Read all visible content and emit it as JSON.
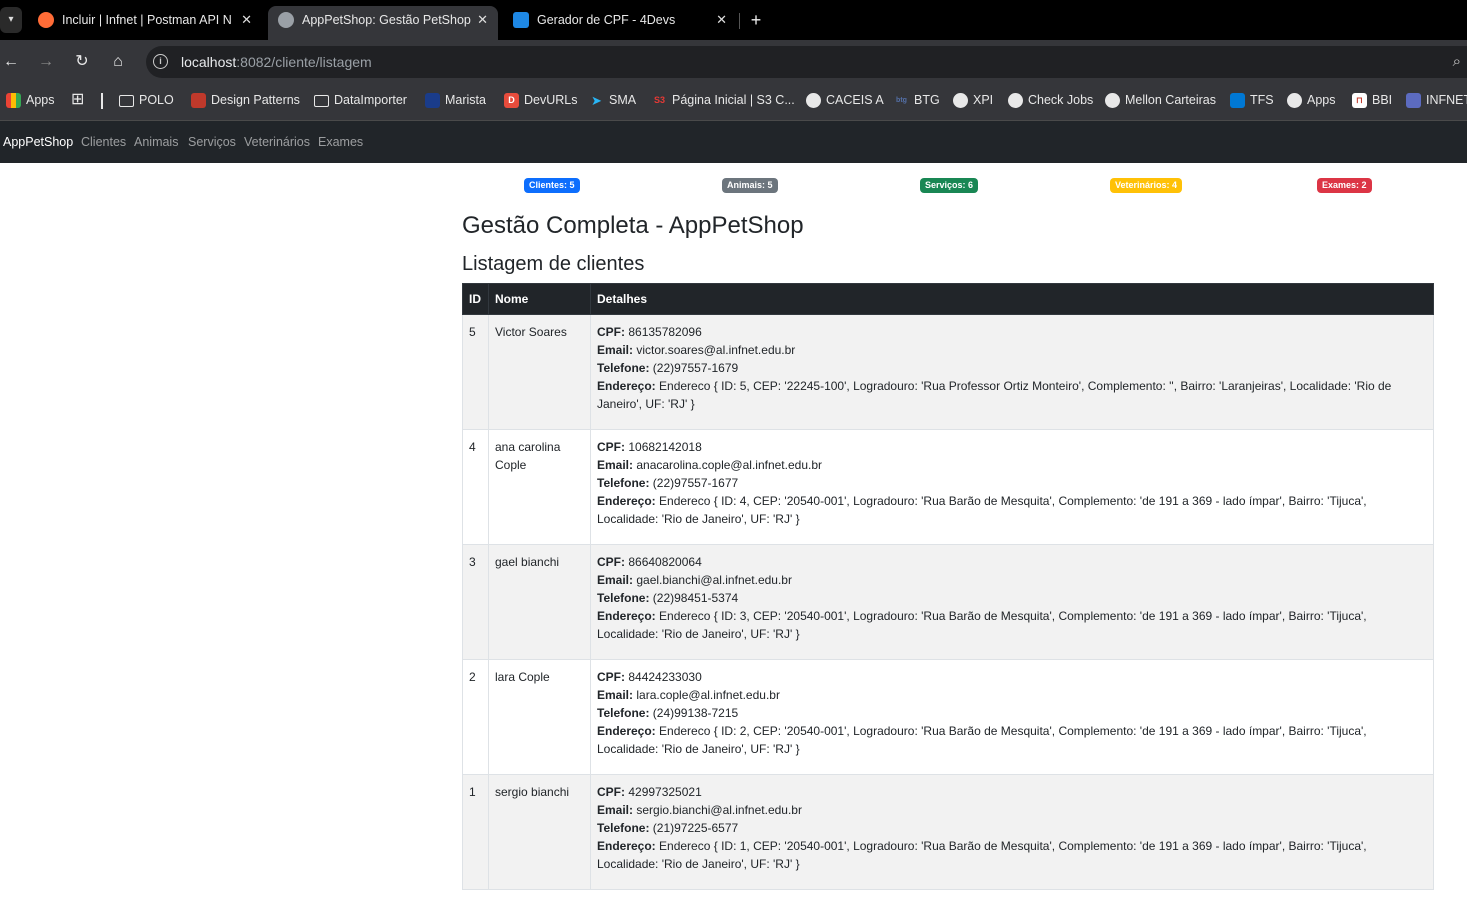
{
  "browser": {
    "tabs": [
      {
        "title": "Incluir | Infnet | Postman API Ne",
        "active": false,
        "favicon_color": "#ff6c37"
      },
      {
        "title": "AppPetShop: Gestão PetShop",
        "active": true,
        "favicon_color": "#9aa0a6"
      },
      {
        "title": "Gerador de CPF - 4Devs",
        "active": false,
        "favicon_color": "#1e88e5"
      }
    ],
    "close_glyph": "✕",
    "new_tab_glyph": "+",
    "url_host": "localhost",
    "url_rest": ":8082/cliente/listagem",
    "bookmarks": [
      {
        "label": "Apps",
        "icon": "apps-grid-icon"
      },
      {
        "label": "POLO",
        "icon": "folder-icon"
      },
      {
        "label": "Design Patterns",
        "icon": "design-patterns-icon"
      },
      {
        "label": "DataImporter",
        "icon": "folder-icon"
      },
      {
        "label": "Marista",
        "icon": "marista-icon"
      },
      {
        "label": "DevURLs",
        "icon": "devurls-icon"
      },
      {
        "label": "SMA",
        "icon": "sma-icon"
      },
      {
        "label": "Página Inicial | S3 C...",
        "icon": "s3-icon"
      },
      {
        "label": "CACEIS A",
        "icon": "globe-icon"
      },
      {
        "label": "BTG",
        "icon": "btg-icon"
      },
      {
        "label": "XPI",
        "icon": "globe-icon"
      },
      {
        "label": "Check Jobs",
        "icon": "globe-icon"
      },
      {
        "label": "Mellon Carteiras",
        "icon": "globe-icon"
      },
      {
        "label": "TFS",
        "icon": "azure-devops-icon"
      },
      {
        "label": "Apps",
        "icon": "globe-icon"
      },
      {
        "label": "BBI",
        "icon": "bbi-icon"
      },
      {
        "label": "INFNET",
        "icon": "infnet-icon"
      }
    ]
  },
  "navbar": {
    "brand": "AppPetShop",
    "links": [
      "Clientes",
      "Animais",
      "Serviços",
      "Veterinários",
      "Exames"
    ]
  },
  "badges": [
    {
      "label": "Clientes: 5",
      "color": "#0d6efd"
    },
    {
      "label": "Animais: 5",
      "color": "#6c757d"
    },
    {
      "label": "Serviços: 6",
      "color": "#198754"
    },
    {
      "label": "Veterinários: 4",
      "color": "#ffc107"
    },
    {
      "label": "Exames: 2",
      "color": "#dc3545"
    }
  ],
  "page": {
    "title": "Gestão Completa - AppPetShop",
    "subtitle": "Listagem de clientes"
  },
  "table": {
    "headers": [
      "ID",
      "Nome",
      "Detalhes"
    ],
    "detail_labels": {
      "cpf": "CPF:",
      "email": "Email:",
      "telefone": "Telefone:",
      "endereco": "Endereço:"
    },
    "rows": [
      {
        "id": "5",
        "nome": "Victor Soares",
        "cpf": "86135782096",
        "email": "victor.soares@al.infnet.edu.br",
        "telefone": "(22)97557-1679",
        "endereco": "Endereco { ID: 5, CEP: '22245-100', Logradouro: 'Rua Professor Ortiz Monteiro', Complemento: '', Bairro: 'Laranjeiras', Localidade: 'Rio de Janeiro', UF: 'RJ' }"
      },
      {
        "id": "4",
        "nome": "ana carolina Cople",
        "cpf": "10682142018",
        "email": "anacarolina.cople@al.infnet.edu.br",
        "telefone": "(22)97557-1677",
        "endereco": "Endereco { ID: 4, CEP: '20540-001', Logradouro: 'Rua Barão de Mesquita', Complemento: 'de 191 a 369 - lado ímpar', Bairro: 'Tijuca', Localidade: 'Rio de Janeiro', UF: 'RJ' }"
      },
      {
        "id": "3",
        "nome": "gael bianchi",
        "cpf": "86640820064",
        "email": "gael.bianchi@al.infnet.edu.br",
        "telefone": "(22)98451-5374",
        "endereco": "Endereco { ID: 3, CEP: '20540-001', Logradouro: 'Rua Barão de Mesquita', Complemento: 'de 191 a 369 - lado ímpar', Bairro: 'Tijuca', Localidade: 'Rio de Janeiro', UF: 'RJ' }"
      },
      {
        "id": "2",
        "nome": "lara Cople",
        "cpf": "84424233030",
        "email": "lara.cople@al.infnet.edu.br",
        "telefone": "(24)99138-7215",
        "endereco": "Endereco { ID: 2, CEP: '20540-001', Logradouro: 'Rua Barão de Mesquita', Complemento: 'de 191 a 369 - lado ímpar', Bairro: 'Tijuca', Localidade: 'Rio de Janeiro', UF: 'RJ' }"
      },
      {
        "id": "1",
        "nome": "sergio bianchi",
        "cpf": "42997325021",
        "email": "sergio.bianchi@al.infnet.edu.br",
        "telefone": "(21)97225-6577",
        "endereco": "Endereco { ID: 1, CEP: '20540-001', Logradouro: 'Rua Barão de Mesquita', Complemento: 'de 191 a 369 - lado ímpar', Bairro: 'Tijuca', Localidade: 'Rio de Janeiro', UF: 'RJ' }"
      }
    ]
  }
}
